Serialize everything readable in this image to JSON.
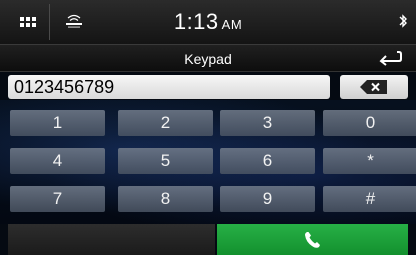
{
  "status_bar": {
    "time": "1:13",
    "ampm": "AM",
    "icons": [
      "grid-icon",
      "siriusxm-icon",
      "bluetooth-icon"
    ]
  },
  "title_bar": {
    "title": "Keypad",
    "icons": [
      "back-arrow-icon"
    ]
  },
  "input": {
    "value": "0123456789",
    "delete_icon": "backspace-icon"
  },
  "keys": [
    "1",
    "2",
    "3",
    "0",
    "4",
    "5",
    "6",
    "*",
    "7",
    "8",
    "9",
    "#"
  ],
  "call": {
    "icon": "phone-icon"
  },
  "colors": {
    "call_green": "#1fa33c",
    "key_gray": "#6b7584"
  }
}
